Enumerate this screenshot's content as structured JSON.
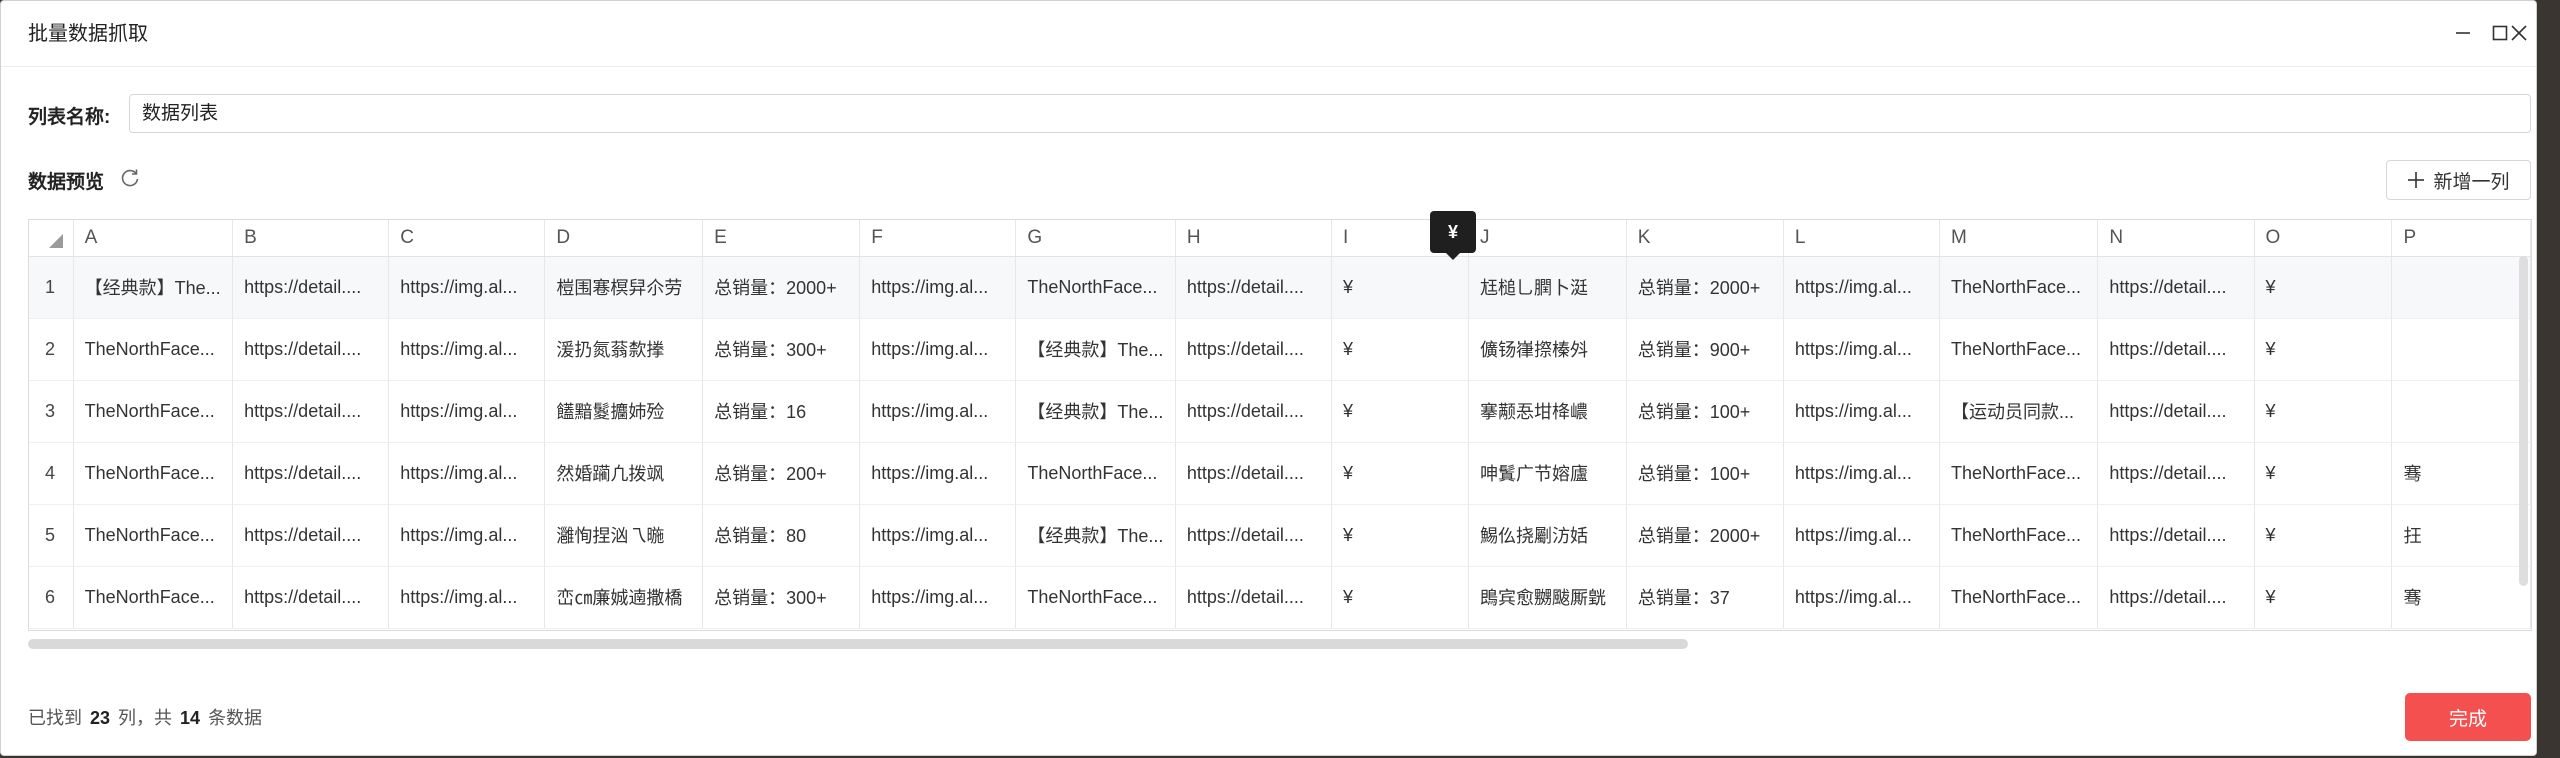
{
  "window": {
    "title": "批量数据抓取"
  },
  "form": {
    "name_label": "列表名称:",
    "name_value": "数据列表"
  },
  "preview": {
    "label": "数据预览",
    "add_column_label": "新增一列"
  },
  "table": {
    "columns": [
      "A",
      "B",
      "C",
      "D",
      "E",
      "F",
      "G",
      "H",
      "I",
      "J",
      "K",
      "L",
      "M",
      "N",
      "O",
      "P"
    ],
    "rows": [
      [
        "1",
        "【经典款】The...",
        "https://detail....",
        "https://img.al...",
        "榿围寋榠舁尒劳",
        "总销量：2000+",
        "https://img.al...",
        "TheNorthFace...",
        "https://detail....",
        "¥",
        "尪槌乚膶卜涏",
        "总销量：2000+",
        "https://img.al...",
        "TheNorthFace...",
        "https://detail....",
        "¥",
        ""
      ],
      [
        "2",
        "TheNorthFace...",
        "https://detail....",
        "https://img.al...",
        "湲扔氮蓊歀搼",
        "总销量：300+",
        "https://img.al...",
        "【经典款】The...",
        "https://detail....",
        "¥",
        "儣钖嵂摖榛斘",
        "总销量：900+",
        "https://img.al...",
        "TheNorthFace...",
        "https://detail....",
        "¥",
        ""
      ],
      [
        "3",
        "TheNorthFace...",
        "https://detail....",
        "https://img.al...",
        "饚黯鬉攟姉殓",
        "总销量：16",
        "https://img.al...",
        "【经典款】The...",
        "https://detail....",
        "¥",
        "搴颟忢坩栙嶩",
        "总销量：100+",
        "https://img.al...",
        "【运动员同款...",
        "https://detail....",
        "¥",
        ""
      ],
      [
        "4",
        "TheNorthFace...",
        "https://detail....",
        "https://img.al...",
        "然婚躏凢拨飒",
        "总销量：200+",
        "https://img.al...",
        "TheNorthFace...",
        "https://detail....",
        "¥",
        "呻鬒广节嫆廬",
        "总销量：100+",
        "https://img.al...",
        "TheNorthFace...",
        "https://detail....",
        "¥",
        "骞"
      ],
      [
        "5",
        "TheNorthFace...",
        "https://detail....",
        "https://img.al...",
        "灉恂捏汹乁暆",
        "总销量：80",
        "https://img.al...",
        "【经典款】The...",
        "https://detail....",
        "¥",
        "鯣仫挠劚汸姡",
        "总销量：2000+",
        "https://img.al...",
        "TheNorthFace...",
        "https://detail....",
        "¥",
        "抂"
      ],
      [
        "6",
        "TheNorthFace...",
        "https://detail....",
        "https://img.al...",
        "峦㎝廉娍遖撒橋",
        "总销量：300+",
        "https://img.al...",
        "TheNorthFace...",
        "https://detail....",
        "¥",
        "鵖宾愈嬲颰厮皝",
        "总销量：37",
        "https://img.al...",
        "TheNorthFace...",
        "https://detail....",
        "¥",
        "骞"
      ]
    ]
  },
  "tooltip": {
    "text": "¥"
  },
  "footer": {
    "prefix": "已找到",
    "cols": "23",
    "mid": "列，共",
    "rows": "14",
    "suffix": "条数据",
    "done_label": "完成"
  },
  "icons": {
    "minimize": "minimize-icon",
    "maximize": "maximize-icon",
    "close": "close-icon",
    "refresh": "refresh-icon",
    "plus": "plus-icon"
  },
  "colors": {
    "primary_button": "#f4504f",
    "tooltip_bg": "#1f1f1f"
  }
}
